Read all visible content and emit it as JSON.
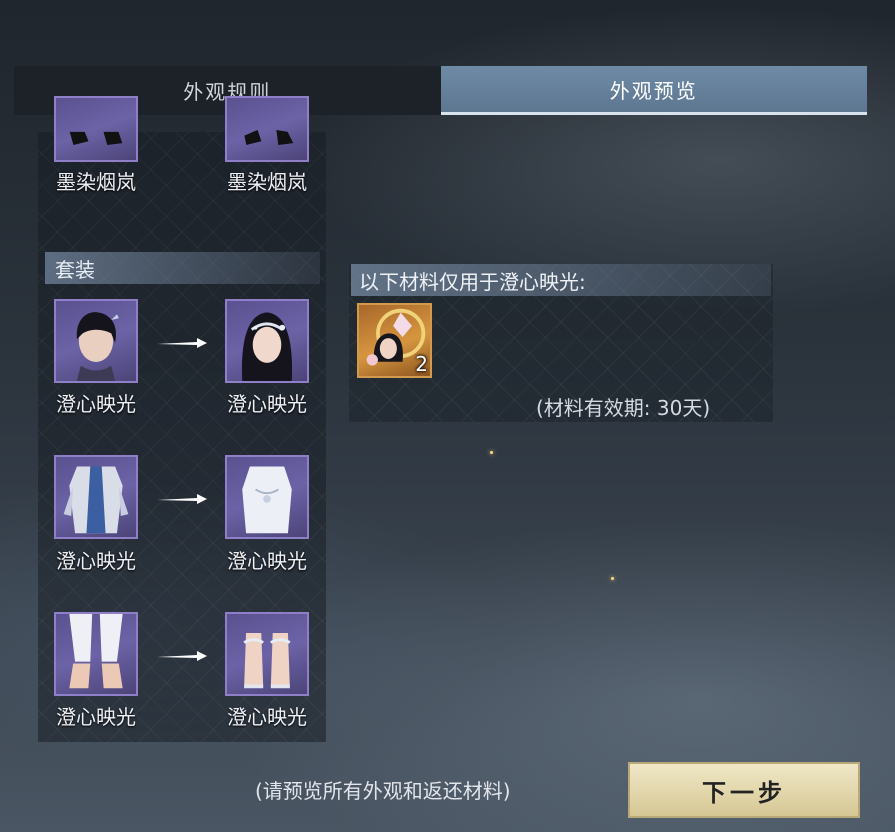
{
  "tabs": [
    {
      "label": "外观规则",
      "active": false
    },
    {
      "label": "外观预览",
      "active": true
    }
  ],
  "top_items": [
    {
      "label": "墨染烟岚"
    },
    {
      "label": "墨染烟岚"
    }
  ],
  "section": {
    "title": "套装",
    "rows": [
      {
        "from": "澄心映光",
        "to": "澄心映光",
        "from_icon": "male-hair-icon",
        "to_icon": "female-hair-icon"
      },
      {
        "from": "澄心映光",
        "to": "澄心映光",
        "from_icon": "outfit-icon",
        "to_icon": "outfit-icon"
      },
      {
        "from": "澄心映光",
        "to": "澄心映光",
        "from_icon": "feet-icon",
        "to_icon": "feet-icon"
      }
    ]
  },
  "materials": {
    "header": "以下材料仅用于澄心映光:",
    "item_count": "2",
    "validity": "(材料有效期: 30天)"
  },
  "footer": {
    "note": "(请预览所有外观和返还材料)",
    "next_label": "下一步"
  },
  "colors": {
    "accent_active_tab": "#6f8aa5",
    "icon_border": "#8f7fc8",
    "material_border": "#d39a4d",
    "button_bg": "#e3d8ae"
  }
}
